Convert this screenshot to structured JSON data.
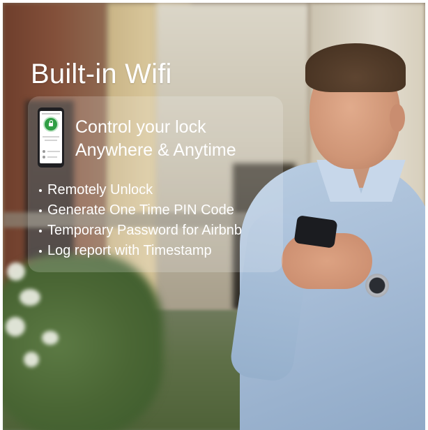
{
  "headline": "Built-in Wifi",
  "panel": {
    "line1": "Control your lock",
    "line2": "Anywhere & Anytime"
  },
  "features": [
    "Remotely Unlock",
    "Generate One Time PIN Code",
    "Temporary Password for Airbnb",
    "Log report with Timestamp"
  ],
  "icons": {
    "phone_mockup": "smartphone-app-icon",
    "lock": "lock-icon"
  },
  "colors": {
    "text": "#ffffff",
    "lock_accent": "#2f9e44",
    "shirt": "#a6bcd6"
  }
}
